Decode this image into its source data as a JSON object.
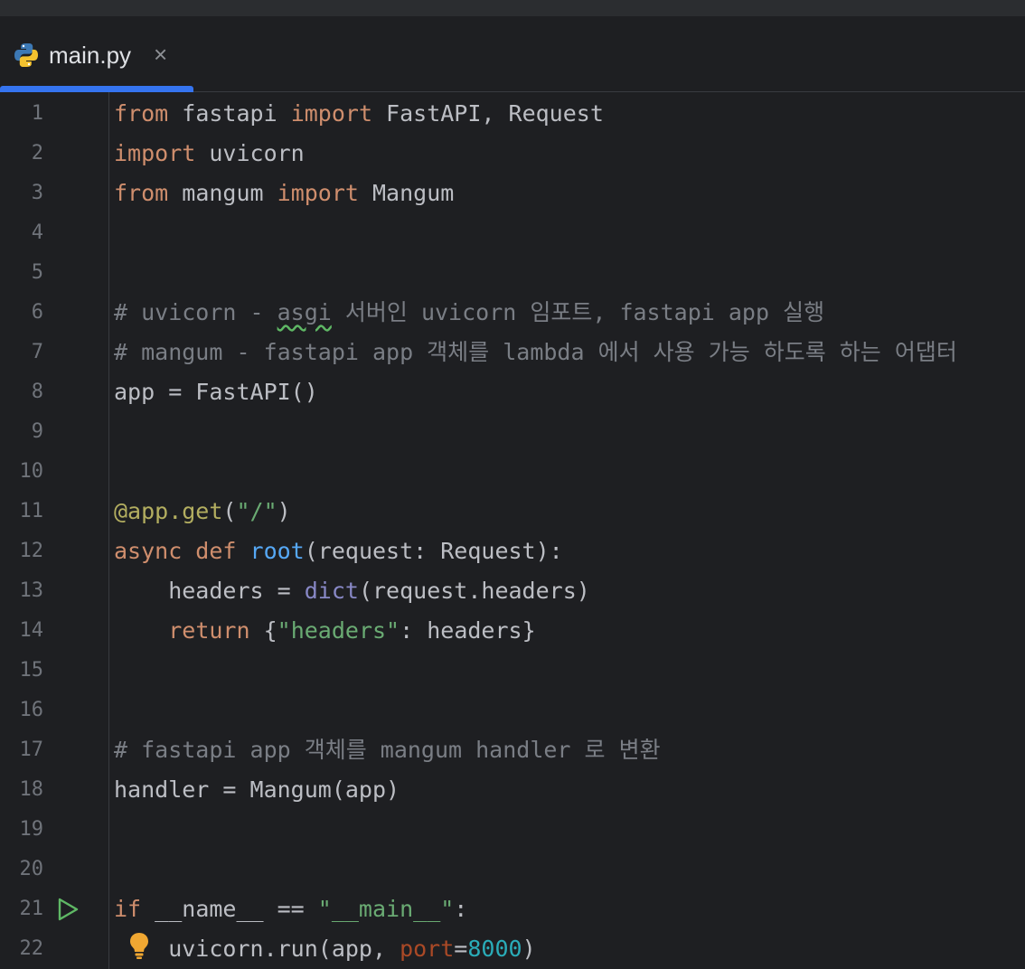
{
  "tab": {
    "filename": "main.py",
    "close_glyph": "×",
    "icon": "python-file-icon"
  },
  "colors": {
    "background": "#1e1f22",
    "keyword": "#cf8e6d",
    "comment": "#7a7e85",
    "string": "#6aab73",
    "decorator": "#b3ae60",
    "function": "#56a8f5",
    "builtin": "#8888c6",
    "number": "#2aacb8",
    "named_param": "#aa4926",
    "accent": "#3574f0"
  },
  "editor": {
    "line_numbers": [
      "1",
      "2",
      "3",
      "4",
      "5",
      "6",
      "7",
      "8",
      "9",
      "10",
      "11",
      "12",
      "13",
      "14",
      "15",
      "16",
      "17",
      "18",
      "19",
      "20",
      "21",
      "22"
    ],
    "lines": [
      {
        "n": 1,
        "tokens": [
          {
            "t": "from",
            "c": "kw"
          },
          {
            "t": " fastapi ",
            "c": ""
          },
          {
            "t": "import",
            "c": "kw"
          },
          {
            "t": " FastAPI, Request",
            "c": ""
          }
        ]
      },
      {
        "n": 2,
        "tokens": [
          {
            "t": "import",
            "c": "kw"
          },
          {
            "t": " uvicorn",
            "c": ""
          }
        ]
      },
      {
        "n": 3,
        "tokens": [
          {
            "t": "from",
            "c": "kw"
          },
          {
            "t": " mangum ",
            "c": ""
          },
          {
            "t": "import",
            "c": "kw"
          },
          {
            "t": " Mangum",
            "c": ""
          }
        ]
      },
      {
        "n": 4,
        "tokens": []
      },
      {
        "n": 5,
        "tokens": []
      },
      {
        "n": 6,
        "tokens": [
          {
            "t": "# uvicorn - ",
            "c": "cmt"
          },
          {
            "t": "asgi",
            "c": "cmt squiggle"
          },
          {
            "t": " 서버인 uvicorn 임포트, fastapi app 실행",
            "c": "cmt"
          }
        ]
      },
      {
        "n": 7,
        "tokens": [
          {
            "t": "# mangum - fastapi app 객체를 lambda 에서 사용 가능 하도록 하는 어댑터",
            "c": "cmt"
          }
        ]
      },
      {
        "n": 8,
        "tokens": [
          {
            "t": "app = FastAPI()",
            "c": ""
          }
        ]
      },
      {
        "n": 9,
        "tokens": []
      },
      {
        "n": 10,
        "tokens": []
      },
      {
        "n": 11,
        "tokens": [
          {
            "t": "@app.get",
            "c": "deco"
          },
          {
            "t": "(",
            "c": ""
          },
          {
            "t": "\"/\"",
            "c": "str"
          },
          {
            "t": ")",
            "c": ""
          }
        ]
      },
      {
        "n": 12,
        "tokens": [
          {
            "t": "async def ",
            "c": "kw"
          },
          {
            "t": "root",
            "c": "fn"
          },
          {
            "t": "(request: Request):",
            "c": ""
          }
        ]
      },
      {
        "n": 13,
        "tokens": [
          {
            "t": "    headers = ",
            "c": ""
          },
          {
            "t": "dict",
            "c": "builtin"
          },
          {
            "t": "(request.headers)",
            "c": ""
          }
        ]
      },
      {
        "n": 14,
        "tokens": [
          {
            "t": "    ",
            "c": ""
          },
          {
            "t": "return",
            "c": "kw"
          },
          {
            "t": " {",
            "c": ""
          },
          {
            "t": "\"headers\"",
            "c": "str"
          },
          {
            "t": ": headers}",
            "c": ""
          }
        ]
      },
      {
        "n": 15,
        "tokens": []
      },
      {
        "n": 16,
        "tokens": []
      },
      {
        "n": 17,
        "tokens": [
          {
            "t": "# fastapi app 객체를 mangum handler 로 변환",
            "c": "cmt"
          }
        ]
      },
      {
        "n": 18,
        "tokens": [
          {
            "t": "handler = Mangum(app)",
            "c": ""
          }
        ]
      },
      {
        "n": 19,
        "tokens": []
      },
      {
        "n": 20,
        "tokens": []
      },
      {
        "n": 21,
        "tokens": [
          {
            "t": "if",
            "c": "kw"
          },
          {
            "t": " __name__ == ",
            "c": ""
          },
          {
            "t": "\"__main__\"",
            "c": "str"
          },
          {
            "t": ":",
            "c": ""
          }
        ]
      },
      {
        "n": 22,
        "tokens": [
          {
            "t": "    uvicorn.run(app, ",
            "c": ""
          },
          {
            "t": "port",
            "c": "param"
          },
          {
            "t": "=",
            "c": ""
          },
          {
            "t": "8000",
            "c": "num"
          },
          {
            "t": ")",
            "c": ""
          }
        ]
      }
    ],
    "gutter_icons": {
      "run_line": 21,
      "run_icon": "run-triangle-icon",
      "intention_line": 22,
      "intention_icon": "lightbulb-icon"
    }
  }
}
